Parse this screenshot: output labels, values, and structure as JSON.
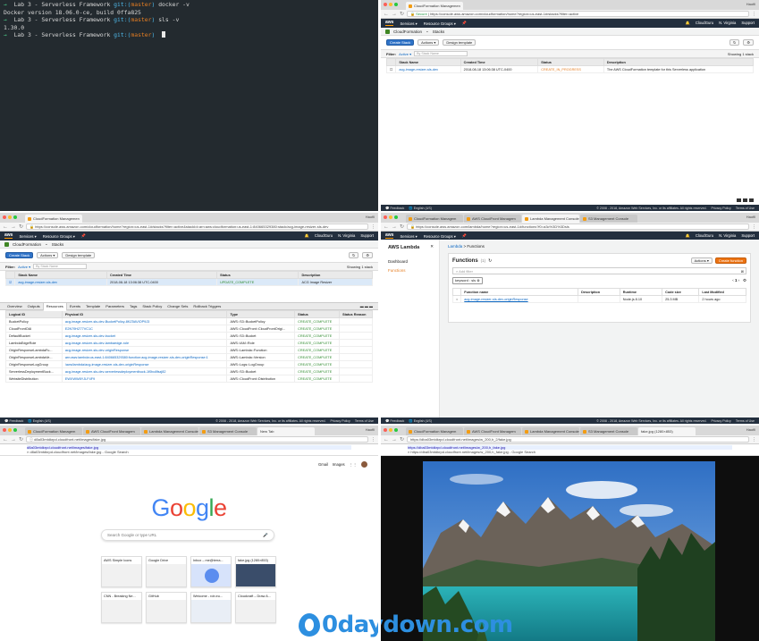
{
  "q1_terminal": {
    "lines": [
      {
        "prompt": "→",
        "dir": "Lab 3 - Serverless Framework",
        "git": "git:(",
        "branch": "master",
        "git_end": ")",
        "cmd": " docker -v"
      },
      {
        "output": "Docker version 18.06.0-ce, build 0ffa825"
      },
      {
        "prompt": "→",
        "dir": "Lab 3 - Serverless Framework",
        "git": "git:(",
        "branch": "master",
        "git_end": ")",
        "cmd": " sls -v"
      },
      {
        "output": "1.30.0"
      },
      {
        "prompt": "→",
        "dir": "Lab 3 - Serverless Framework",
        "git": "git:(",
        "branch": "master",
        "git_end": ")",
        "cmd": " "
      }
    ]
  },
  "q2_cloudformation_progress": {
    "tab": "CloudFormation Managemen",
    "user": "Haofil",
    "secure": "Secure",
    "url": "https://console.aws.amazon.com/cloudformation/home?region=us-east-1#/stacks?filter=active",
    "aws_logo": "aws",
    "services": "Services",
    "resource_groups": "Resource Groups",
    "nav_right": [
      "CloudGuru",
      "N. Virginia",
      "Support"
    ],
    "service_name": "CloudFormation",
    "section": "Stacks",
    "create_stack": "Create Stack",
    "actions": "Actions",
    "design_template": "Design template",
    "filter_label": "Filter:",
    "filter_value": "Active",
    "filter_placeholder": "By Stack Name",
    "showing": "Showing 1 stack",
    "headers": [
      "Stack Name",
      "Created Time",
      "Status",
      "Description"
    ],
    "row": [
      "acg-image-resizer-sls-dev",
      "2018-08-18 13:06:38 UTC-0400",
      "CREATE_IN_PROGRESS",
      "The AWS CloudFormation template for this Serverless application"
    ],
    "footer_feedback": "Feedback",
    "footer_lang": "English (US)",
    "footer_copy": "© 2008 - 2018, Amazon Web Services, Inc. or its affiliates. All rights reserved.",
    "footer_privacy": "Privacy Policy",
    "footer_terms": "Terms of Use"
  },
  "q3_cloudformation_resources": {
    "tab": "CloudFormation Managemen",
    "url": "https://console.aws.amazon.com/cloudformation/home?region=us-east-1#/stacks?filter=active&stackId=arn:aws:cloudformation:us-east-1:840665329380:stack/acg-image-resizer-sls-dev",
    "aws_logo": "aws",
    "services": "Services",
    "resource_groups": "Resource Groups",
    "nav_right": [
      "CloudGuru",
      "N. Virginia",
      "Support"
    ],
    "service_name": "CloudFormation",
    "section": "Stacks",
    "create_stack": "Create Stack",
    "actions": "Actions",
    "design_template": "Design template",
    "filter_label": "Filter:",
    "filter_value": "Active",
    "filter_placeholder": "By Stack Name",
    "showing": "Showing 1 stack",
    "headers": [
      "Stack Name",
      "Created Time",
      "Status",
      "Description"
    ],
    "row": [
      "acg-image-resizer-sls-dev",
      "2018-08-18 13:06:38 UTC-0400",
      "UPDATE_COMPLETE",
      "ACG Image Resizer"
    ],
    "res_tabs": [
      "Overview",
      "Outputs",
      "Resources",
      "Events",
      "Template",
      "Parameters",
      "Tags",
      "Stack Policy",
      "Change Sets",
      "Rollback Triggers"
    ],
    "res_headers": [
      "Logical ID",
      "Physical ID",
      "Type",
      "Status",
      "Status Reason"
    ],
    "res_rows": [
      [
        "BucketPolicy",
        "acg-image-resizer-sls-dev-BucketPolicy-8KZ5AVIOP9J3",
        "AWS::S3::BucketPolicy",
        "CREATE_COMPLETE"
      ],
      [
        "CloudFrontOAI",
        "E2N79HZ77VC1C",
        "AWS::CloudFront::CloudFrontOrigi...",
        "CREATE_COMPLETE"
      ],
      [
        "DefaultBucket",
        "acg-image-resizer-sls-dev-bucket",
        "AWS::S3::Bucket",
        "CREATE_COMPLETE"
      ],
      [
        "LambdaEdgeRole",
        "acg-image-resizer-sls-dev-lambaedge-role",
        "AWS::IAM::Role",
        "CREATE_COMPLETE"
      ],
      [
        "OriginResponseLambdaFu...",
        "acg-image-resizer-sls-dev-originResponse",
        "AWS::Lambda::Function",
        "CREATE_COMPLETE"
      ],
      [
        "OriginResponseLambdaVe...",
        "arn:aws:lambda:us-east-1:840665329380:function:acg-image-resizer-sls-dev-originResponse:1",
        "AWS::Lambda::Version",
        "CREATE_COMPLETE"
      ],
      [
        "OriginResponseLogGroup",
        "/aws/lambda/acg-image-resizer-sls-dev-originResponse",
        "AWS::Logs::LogGroup",
        "CREATE_COMPLETE"
      ],
      [
        "ServerlessDeploymentBuck...",
        "acg-image-resizer-sls-dev-serverlessdeploymentbuck-1f0bo8fszj82",
        "AWS::S3::Bucket",
        "CREATE_COMPLETE"
      ],
      [
        "WebsiteDistribution",
        "EWXWW8YJLF4F9",
        "AWS::CloudFront::Distribution",
        "CREATE_COMPLETE"
      ]
    ],
    "footer_feedback": "Feedback",
    "footer_lang": "English (US)",
    "footer_copy": "© 2008 - 2018, Amazon Web Services, Inc. or its affiliates. All rights reserved.",
    "footer_privacy": "Privacy Policy",
    "footer_terms": "Terms of Use"
  },
  "q4_lambda": {
    "tabs": [
      "CloudFormation Managem",
      "AWS CloudFront Managem",
      "Lambda Management Console",
      "S3 Management Console"
    ],
    "url": "https://console.aws.amazon.com/lambda/home?region=us-east-1#/functions?f0=a3c%3D%3Dsls",
    "aws_logo": "aws",
    "services": "Services",
    "resource_groups": "Resource Groups",
    "nav_right": [
      "CloudGuru",
      "N. Virginia",
      "Support"
    ],
    "sidebar_title": "AWS Lambda",
    "sidebar_items": [
      "Dashboard",
      "Functions"
    ],
    "breadcrumb": [
      "Lambda",
      "Functions"
    ],
    "title": "Functions",
    "count": "(1)",
    "actions": "Actions",
    "create_function": "Create function",
    "filter_placeholder": "Add filter",
    "filter_chip": "keyword : sls",
    "page": "1",
    "headers": [
      "Function name",
      "Description",
      "Runtime",
      "Code size",
      "Last Modified"
    ],
    "row": [
      "acg-image-resizer-sls-dev-originResponse",
      "",
      "Node.js 8.10",
      "25.3 MB",
      "2 hours ago"
    ],
    "footer_feedback": "Feedback",
    "footer_lang": "English (US)",
    "footer_copy": "© 2008 - 2018, Amazon Web Services, Inc. or its affiliates. All rights reserved.",
    "footer_privacy": "Privacy Policy",
    "footer_terms": "Terms of Use"
  },
  "q5_newtab": {
    "tabs": [
      "CloudFormation Managem",
      "AWS CloudFront Managem",
      "Lambda Management Console",
      "S3 Management Console",
      "New Tab"
    ],
    "url": "d8a03mtdkrpd.cloudfront.net/images/fake.jpg",
    "suggestions": [
      "d8a03mtdkrpd.cloudfront.net/images/fake.jpg",
      "d8a03mtdkrpd.cloudfront.net/images/fake.jpg - Google Search"
    ],
    "top_links": [
      "Gmail",
      "Images"
    ],
    "logo": [
      "G",
      "o",
      "o",
      "g",
      "l",
      "e"
    ],
    "logo_colors": [
      "#4285f4",
      "#ea4335",
      "#fbbc05",
      "#4285f4",
      "#34a853",
      "#ea4335"
    ],
    "search_placeholder": "Search Google or type URL",
    "tiles": [
      "AWS Simple Icons",
      "Google Drive",
      "Inbox – me@terra...",
      "fake.jpg (1280×853)",
      "CNN - Breaking Ne...",
      "GitHub",
      "Welcome - rob.eu...",
      "Cloudcraft – Draw A..."
    ]
  },
  "q6_image": {
    "tabs": [
      "CloudFormation Managem",
      "AWS CloudFront Managem",
      "Lambda Management Console",
      "S3 Management Console",
      "fake.jpg (1280×853)"
    ],
    "url": "https://dba03mtdkrpd.cloudfront.net/images/w_200,h_2/fake.jpg",
    "suggestions": [
      "https://dba03mtdkrpd.cloudfront.net/images/w_200,h_fake.jpg",
      "https://dba03mtdkrpd.cloudfront.net/images/w_200,h_fake.jpg - Google Search"
    ]
  },
  "watermark": "0daydown.com"
}
